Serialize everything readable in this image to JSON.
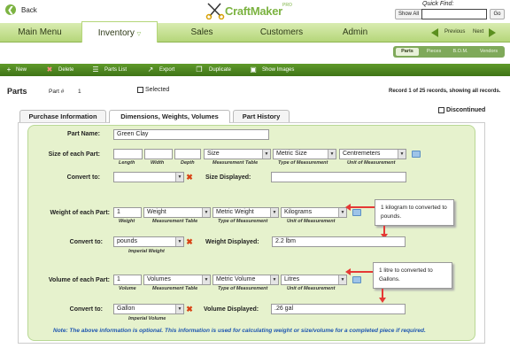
{
  "header": {
    "back_label": "Back",
    "logo_text": "CraftMaker",
    "logo_pro": "PRO",
    "show_all": "Show All",
    "quick_find_label": "Quick Find:",
    "quick_find_value": "",
    "go_label": "Go"
  },
  "nav": {
    "items": [
      "Main Menu",
      "Inventory",
      "Sales",
      "Customers",
      "Admin"
    ],
    "active": "Inventory",
    "previous": "Previous",
    "next": "Next"
  },
  "subtabs": [
    "Parts",
    "Pieces",
    "B.O.M.",
    "Vendors"
  ],
  "toolbar": [
    "New",
    "Delete",
    "Parts List",
    "Export",
    "Duplicate",
    "Show Images"
  ],
  "page": {
    "title": "Parts",
    "part_num_label": "Part #",
    "part_num_value": "1",
    "selected_label": "Selected",
    "record_info": "Record 1 of 25 records, showing all records.",
    "discontinued_label": "Discontinued"
  },
  "tabs": [
    "Purchase Information",
    "Dimensions, Weights, Volumes",
    "Part History"
  ],
  "active_tab": "Dimensions, Weights, Volumes",
  "form": {
    "part_name_label": "Part Name:",
    "part_name_value": "Green Clay",
    "size_label": "Size of each Part:",
    "size_select": "Size",
    "size_type": "Metric Size",
    "size_unit": "Centremeters",
    "size_sub": [
      "Length",
      "Width",
      "Depth",
      "Measurement Table",
      "Type of Measurement",
      "Unit of Measurement"
    ],
    "convert_to_label": "Convert to:",
    "size_convert_value": "",
    "size_displayed_label": "Size Displayed:",
    "size_displayed_value": "",
    "weight_label": "Weight of each Part:",
    "weight_value": "1",
    "weight_table": "Weight",
    "weight_type": "Metric Weight",
    "weight_unit": "Kilograms",
    "weight_sub": [
      "Weight",
      "Measurement Table",
      "Type of Measurement",
      "Unit of Measurement"
    ],
    "weight_convert_value": "pounds",
    "weight_convert_sub": "Imperial Weight",
    "weight_displayed_label": "Weight Displayed:",
    "weight_displayed_value": "2.2 lbm",
    "volume_label": "Volume of each Part:",
    "volume_value": "1",
    "volume_table": "Volumes",
    "volume_type": "Metric Volume",
    "volume_unit": "Litres",
    "volume_sub": [
      "Volume",
      "Measurement Table",
      "Type of Measurement",
      "Unit of Measurement"
    ],
    "volume_convert_value": "Gallon",
    "volume_convert_sub": "Imperial Volume",
    "volume_displayed_label": "Volume Displayed:",
    "volume_displayed_value": ".26 gal"
  },
  "callouts": {
    "weight": "1 kilogram to converted to pounds.",
    "volume": "1 litre to converted to Gallons."
  },
  "note": "Note: The above information is optional. This information is used for calculating weight or size/volume for a completed piece if required.",
  "colors": {
    "nav_green": "#b5d67a",
    "toolbar_green": "#4f8a22",
    "panel_green": "#e6f2cd",
    "note_blue": "#1e56b0",
    "arrow_red": "#e53935"
  }
}
